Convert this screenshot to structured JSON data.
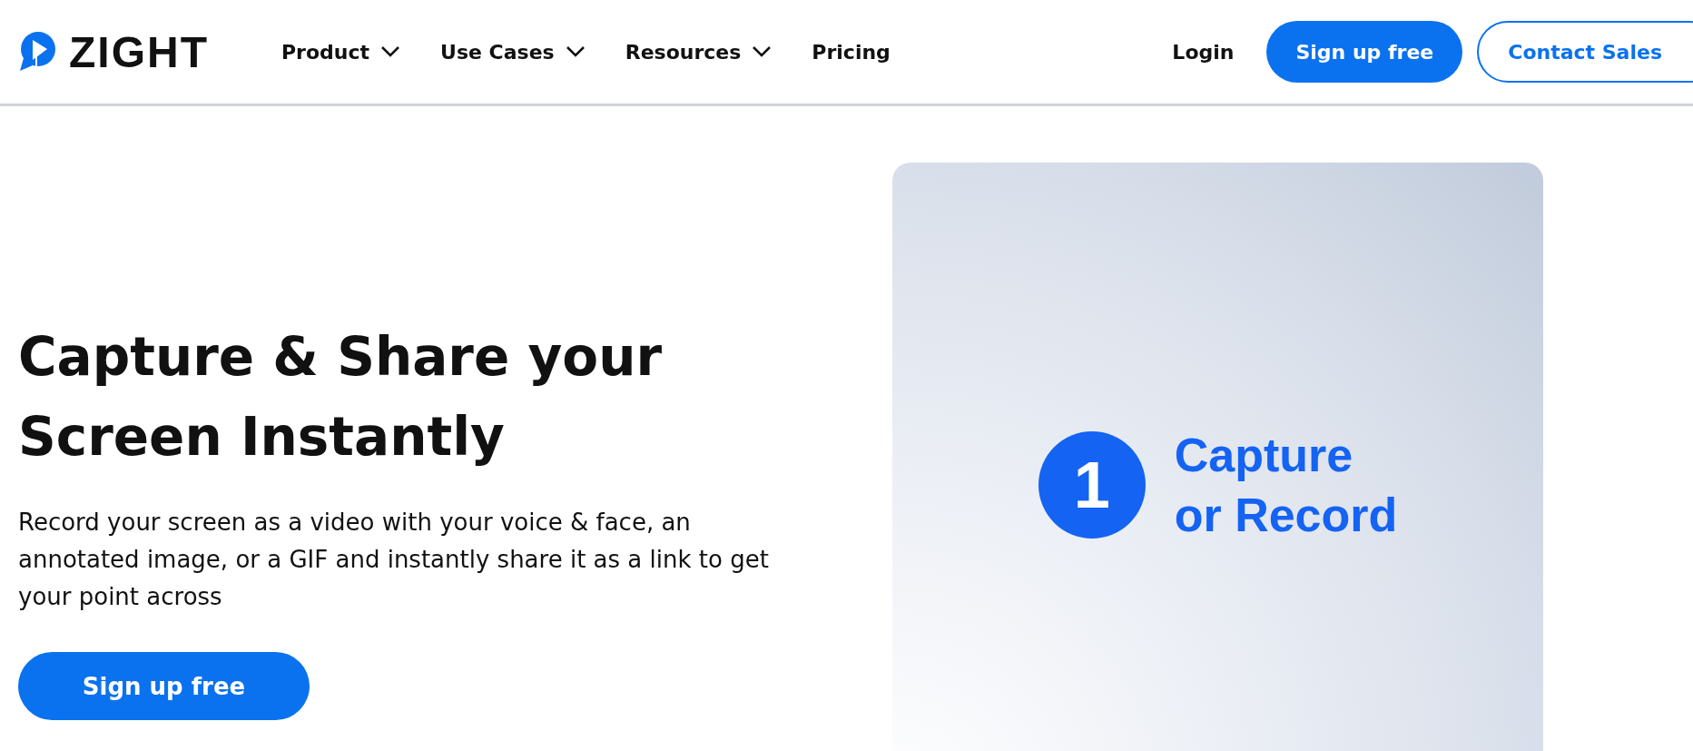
{
  "header": {
    "logo": "ZIGHT",
    "nav": [
      {
        "label": "Product",
        "has_menu": true
      },
      {
        "label": "Use Cases",
        "has_menu": true
      },
      {
        "label": "Resources",
        "has_menu": true
      },
      {
        "label": "Pricing",
        "has_menu": false
      }
    ],
    "login": "Login",
    "buttons": [
      {
        "label": "Sign up free",
        "kind": "primary"
      },
      {
        "label": "Contact Sales",
        "kind": "outline"
      }
    ]
  },
  "hero": {
    "title_lines": [
      "Capture & Share your",
      "Screen Instantly"
    ],
    "description": "Record your screen as a video with your voice & face, an annotated image, or a GIF and instantly share it as a link to get your point across",
    "cta": "Sign up free"
  },
  "card": {
    "step": "1",
    "caption_lines": [
      "Capture",
      "or Record"
    ]
  }
}
